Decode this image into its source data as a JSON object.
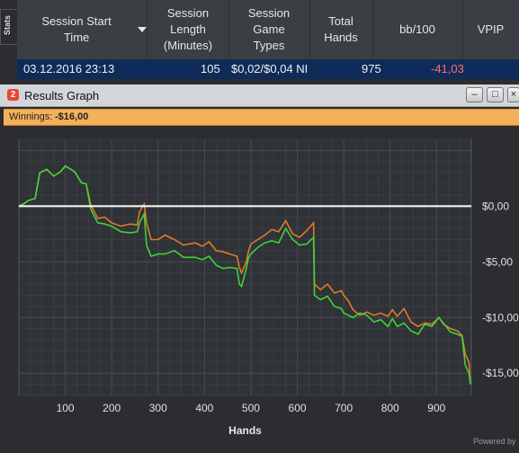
{
  "stats_tab": {
    "label": "Stats"
  },
  "table": {
    "columns": [
      {
        "label": "Session Start Time",
        "sort": "chevron-down-icon"
      },
      {
        "label": "Session Length (Minutes)"
      },
      {
        "label": "Session Game Types"
      },
      {
        "label": "Total Hands"
      },
      {
        "label": "bb/100"
      },
      {
        "label": "VPIP"
      }
    ],
    "row": {
      "start_time": "03.12.2016 23:13",
      "length": "105",
      "game_type": "$0,02/$0,04 NI",
      "hands": "975",
      "bb100": "-41,03"
    }
  },
  "graph_window": {
    "icon_text": "2",
    "title": "Results Graph",
    "buttons": {
      "minimize": "–",
      "maximize": "□",
      "close": "×"
    },
    "winnings_label": "Winnings:",
    "winnings_value": "-$16,00",
    "footer_text": "Powered by"
  },
  "colors": {
    "accent_orange": "#f3b15c",
    "winnings_line": "#e07a2a",
    "showdown_line": "#3fd23a",
    "zero_line": "#ffffff",
    "negative_value": "#ff6b6b"
  },
  "chart_data": {
    "type": "line",
    "xlabel": "Hands",
    "ylabel": "",
    "xlim": [
      0,
      975
    ],
    "ylim": [
      -17,
      6
    ],
    "x_ticks": [
      100,
      200,
      300,
      400,
      500,
      600,
      700,
      800,
      900
    ],
    "y_ticks": [
      0,
      -5,
      -10,
      -15
    ],
    "y_tick_labels": [
      "$0,00",
      "-$5,00",
      "-$10,00",
      "-$15,00"
    ],
    "grid": true,
    "series": [
      {
        "color": "#e07a2a",
        "points": [
          [
            0,
            0
          ],
          [
            10,
            0.2
          ],
          [
            20,
            0.5
          ],
          [
            35,
            0.7
          ],
          [
            45,
            3.0
          ],
          [
            60,
            3.3
          ],
          [
            75,
            2.7
          ],
          [
            90,
            3.1
          ],
          [
            100,
            3.6
          ],
          [
            120,
            3.1
          ],
          [
            135,
            2.1
          ],
          [
            145,
            2.0
          ],
          [
            155,
            0.1
          ],
          [
            170,
            -1.1
          ],
          [
            185,
            -1.0
          ],
          [
            200,
            -1.5
          ],
          [
            220,
            -1.8
          ],
          [
            240,
            -1.6
          ],
          [
            255,
            -1.7
          ],
          [
            260,
            -0.5
          ],
          [
            270,
            0.2
          ],
          [
            275,
            -1.5
          ],
          [
            285,
            -3.0
          ],
          [
            300,
            -3.0
          ],
          [
            315,
            -2.6
          ],
          [
            335,
            -3.0
          ],
          [
            355,
            -3.5
          ],
          [
            380,
            -3.3
          ],
          [
            395,
            -3.6
          ],
          [
            410,
            -3.2
          ],
          [
            425,
            -4.0
          ],
          [
            440,
            -4.1
          ],
          [
            455,
            -4.3
          ],
          [
            470,
            -4.5
          ],
          [
            475,
            -5.5
          ],
          [
            480,
            -6.0
          ],
          [
            490,
            -5.0
          ],
          [
            495,
            -4.0
          ],
          [
            500,
            -3.4
          ],
          [
            515,
            -3.0
          ],
          [
            530,
            -2.6
          ],
          [
            545,
            -2.1
          ],
          [
            560,
            -2.3
          ],
          [
            575,
            -1.3
          ],
          [
            590,
            -2.5
          ],
          [
            605,
            -2.8
          ],
          [
            620,
            -2.2
          ],
          [
            635,
            -1.5
          ],
          [
            637,
            -7.0
          ],
          [
            650,
            -7.5
          ],
          [
            665,
            -7.0
          ],
          [
            680,
            -7.8
          ],
          [
            695,
            -7.6
          ],
          [
            700,
            -8.0
          ],
          [
            710,
            -8.5
          ],
          [
            720,
            -9.3
          ],
          [
            735,
            -9.8
          ],
          [
            750,
            -9.5
          ],
          [
            765,
            -9.8
          ],
          [
            780,
            -9.6
          ],
          [
            795,
            -9.9
          ],
          [
            805,
            -9.3
          ],
          [
            815,
            -9.9
          ],
          [
            830,
            -9.2
          ],
          [
            845,
            -10.4
          ],
          [
            860,
            -10.8
          ],
          [
            875,
            -10.5
          ],
          [
            890,
            -10.6
          ],
          [
            905,
            -10.0
          ],
          [
            915,
            -10.6
          ],
          [
            930,
            -11.0
          ],
          [
            945,
            -11.2
          ],
          [
            955,
            -11.6
          ],
          [
            962,
            -13.3
          ],
          [
            970,
            -14.0
          ],
          [
            973,
            -16.0
          ]
        ]
      },
      {
        "color": "#3fd23a",
        "points": [
          [
            0,
            0
          ],
          [
            10,
            0.2
          ],
          [
            20,
            0.5
          ],
          [
            35,
            0.7
          ],
          [
            45,
            3.0
          ],
          [
            60,
            3.3
          ],
          [
            75,
            2.7
          ],
          [
            90,
            3.1
          ],
          [
            100,
            3.6
          ],
          [
            120,
            3.1
          ],
          [
            135,
            2.1
          ],
          [
            145,
            2.0
          ],
          [
            155,
            -0.3
          ],
          [
            170,
            -1.5
          ],
          [
            185,
            -1.6
          ],
          [
            200,
            -1.8
          ],
          [
            220,
            -2.3
          ],
          [
            240,
            -2.4
          ],
          [
            255,
            -2.3
          ],
          [
            260,
            -1.5
          ],
          [
            270,
            -0.7
          ],
          [
            275,
            -3.5
          ],
          [
            285,
            -4.5
          ],
          [
            300,
            -4.3
          ],
          [
            315,
            -4.3
          ],
          [
            335,
            -4.0
          ],
          [
            355,
            -4.6
          ],
          [
            380,
            -4.6
          ],
          [
            395,
            -4.8
          ],
          [
            410,
            -4.5
          ],
          [
            425,
            -5.3
          ],
          [
            440,
            -5.6
          ],
          [
            455,
            -5.5
          ],
          [
            470,
            -5.6
          ],
          [
            475,
            -7.0
          ],
          [
            480,
            -7.2
          ],
          [
            490,
            -5.6
          ],
          [
            495,
            -4.6
          ],
          [
            500,
            -4.3
          ],
          [
            515,
            -3.7
          ],
          [
            530,
            -3.3
          ],
          [
            545,
            -3.1
          ],
          [
            560,
            -3.3
          ],
          [
            575,
            -2.0
          ],
          [
            590,
            -3.0
          ],
          [
            605,
            -3.5
          ],
          [
            620,
            -3.4
          ],
          [
            635,
            -2.8
          ],
          [
            637,
            -8.0
          ],
          [
            650,
            -8.4
          ],
          [
            665,
            -8.1
          ],
          [
            680,
            -9.0
          ],
          [
            695,
            -9.2
          ],
          [
            700,
            -9.6
          ],
          [
            710,
            -9.8
          ],
          [
            720,
            -10.0
          ],
          [
            735,
            -9.6
          ],
          [
            750,
            -9.8
          ],
          [
            765,
            -10.4
          ],
          [
            780,
            -10.2
          ],
          [
            795,
            -10.8
          ],
          [
            805,
            -10.1
          ],
          [
            815,
            -10.8
          ],
          [
            830,
            -10.5
          ],
          [
            845,
            -11.2
          ],
          [
            860,
            -11.5
          ],
          [
            875,
            -10.6
          ],
          [
            890,
            -10.8
          ],
          [
            905,
            -10.0
          ],
          [
            915,
            -10.5
          ],
          [
            930,
            -11.3
          ],
          [
            945,
            -11.5
          ],
          [
            955,
            -11.7
          ],
          [
            962,
            -14.3
          ],
          [
            970,
            -15.0
          ],
          [
            973,
            -16.0
          ]
        ]
      }
    ]
  }
}
